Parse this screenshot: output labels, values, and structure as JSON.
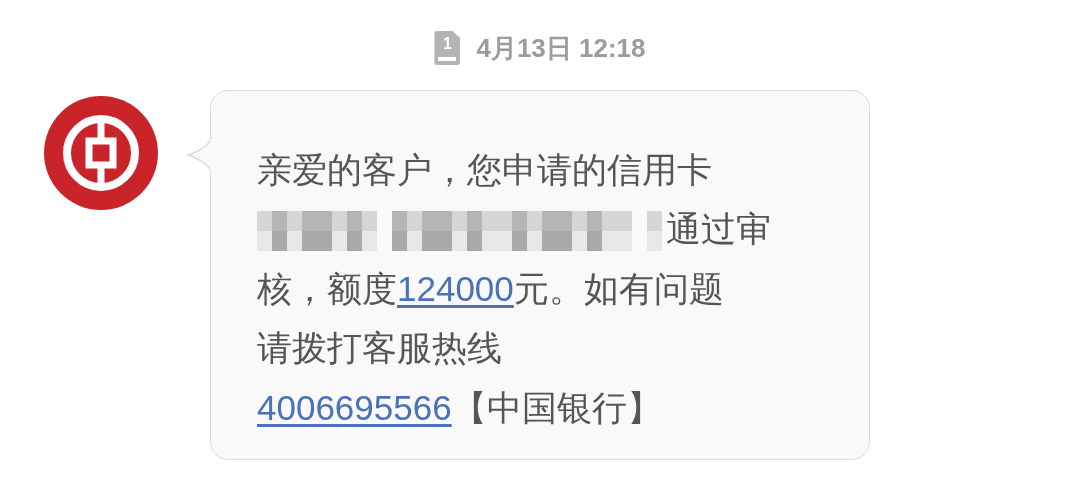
{
  "timestamp": {
    "sim": "1",
    "text": "4月13日 12:18"
  },
  "message": {
    "lines": [
      [
        {
          "kind": "text",
          "text": "亲爱的客户，您申请的信用卡"
        }
      ],
      [
        {
          "kind": "redacted"
        },
        {
          "kind": "text",
          "text": "通过审"
        }
      ],
      [
        {
          "kind": "text",
          "text": "核，额度"
        },
        {
          "kind": "link",
          "text": "124000"
        },
        {
          "kind": "text",
          "text": "元。如有问题"
        }
      ],
      [
        {
          "kind": "text",
          "text": "请拨打客服热线"
        }
      ],
      [
        {
          "kind": "link",
          "text": "4006695566"
        },
        {
          "kind": "text",
          "text": "【中国银行】"
        }
      ]
    ]
  }
}
